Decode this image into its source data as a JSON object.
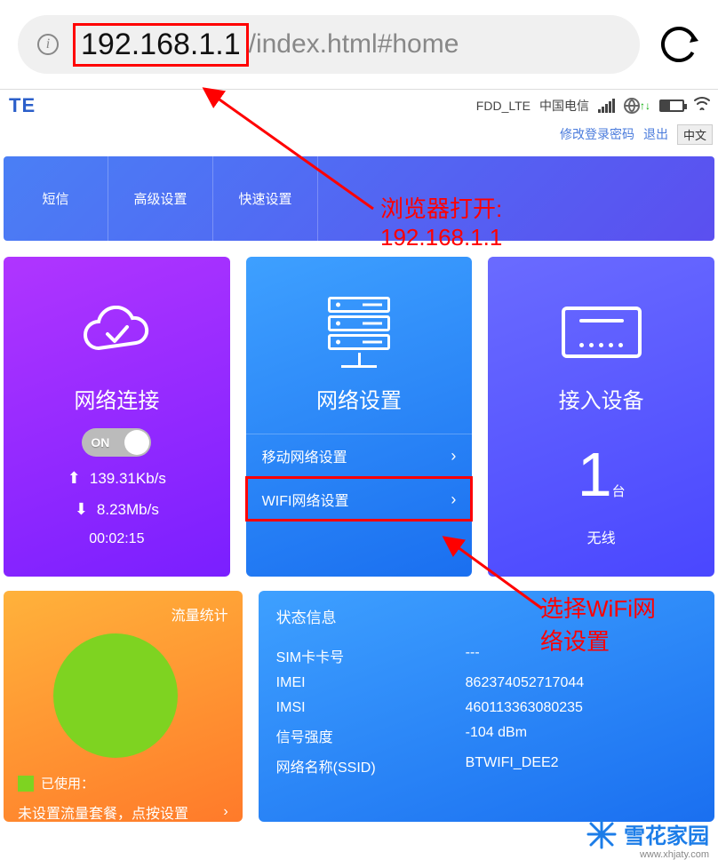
{
  "browser": {
    "url_ip": "192.168.1.1",
    "url_rest": "/index.html#home"
  },
  "header": {
    "logo": "TE",
    "network_mode": "FDD_LTE",
    "carrier": "中国电信",
    "link_change_password": "修改登录密码",
    "link_logout": "退出",
    "language": "中文"
  },
  "nav": {
    "tab_sms": "短信",
    "tab_advanced": "高级设置",
    "tab_quick": "快速设置"
  },
  "card_conn": {
    "title": "网络连接",
    "toggle_state": "ON",
    "upload": "139.31Kb/s",
    "download": "8.23Mb/s",
    "duration": "00:02:15"
  },
  "card_net": {
    "title": "网络设置",
    "link_mobile": "移动网络设置",
    "link_wifi": "WIFI网络设置"
  },
  "card_devices": {
    "title": "接入设备",
    "count": "1",
    "unit": "台",
    "sub": "无线"
  },
  "card_traffic": {
    "title": "流量统计",
    "legend_used": "已使用：",
    "msg": "未设置流量套餐，点按设置"
  },
  "card_status": {
    "title": "状态信息",
    "rows": {
      "sim_label": "SIM卡卡号",
      "sim_value": "---",
      "imei_label": "IMEI",
      "imei_value": "862374052717044",
      "imsi_label": "IMSI",
      "imsi_value": "460113363080235",
      "signal_label": "信号强度",
      "signal_value": "-104 dBm",
      "ssid_label": "网络名称(SSID)",
      "ssid_value": "BTWIFI_DEE2"
    }
  },
  "annotations": {
    "anno1_l1": "浏览器打开:",
    "anno1_l2": "192.168.1.1",
    "anno2_l1": "选择WiFi网",
    "anno2_l2": "络设置"
  },
  "watermark": {
    "text": "雪花家园",
    "url": "www.xhjaty.com"
  }
}
